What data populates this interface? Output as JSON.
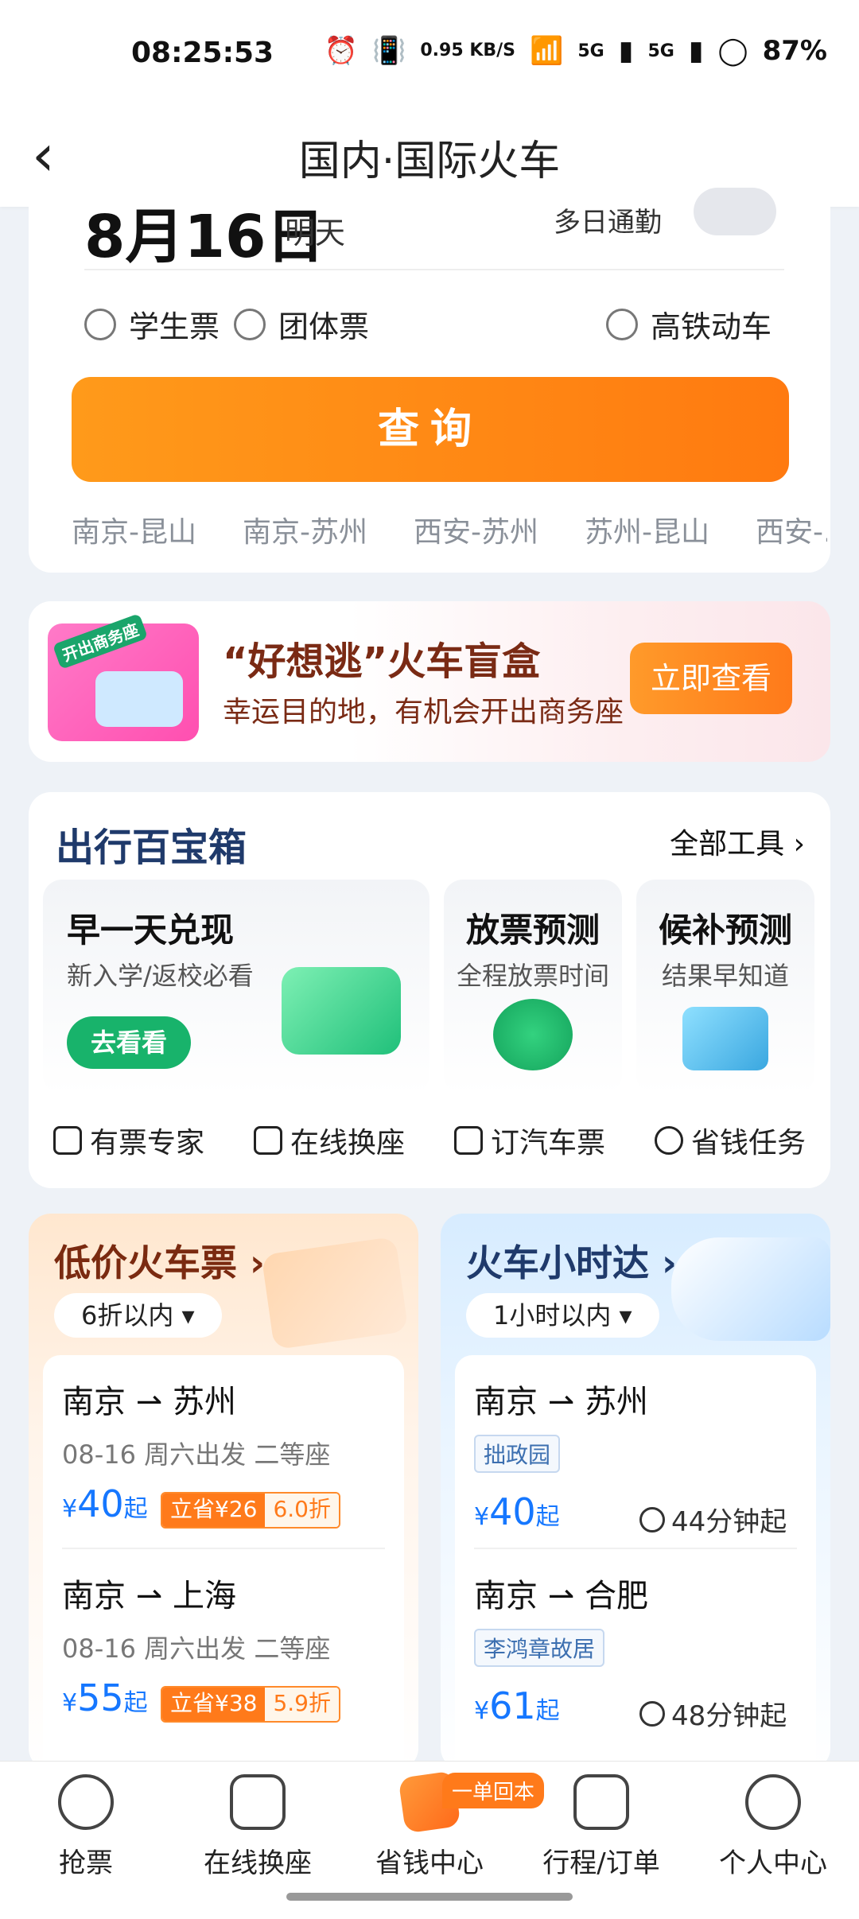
{
  "status": {
    "time": "08:25:53",
    "net_speed": "0.95 KB/S",
    "signal_a": "5G",
    "signal_b": "5G",
    "battery": "87%"
  },
  "header": {
    "title": "国内·国际火车"
  },
  "search": {
    "date": "8月16日",
    "date_sub": "明天",
    "multi_day": "多日通勤",
    "options": [
      "学生票",
      "团体票",
      "高铁动车"
    ],
    "query_button": "查询",
    "history": [
      "南京-昆山",
      "南京-苏州",
      "西安-苏州",
      "苏州-昆山",
      "西安-..."
    ]
  },
  "banner": {
    "gift_tag": "开出商务座",
    "title": "“好想逃”火车盲盒",
    "subtitle": "幸运目的地，有机会开出商务座",
    "button": "立即查看"
  },
  "toolbox": {
    "title": "出行百宝箱",
    "all_tools": "全部工具 ›",
    "tiles": [
      {
        "title": "早一天兑现",
        "sub": "新入学/返校必看",
        "button": "去看看"
      },
      {
        "title": "放票预测",
        "sub": "全程放票时间"
      },
      {
        "title": "候补预测",
        "sub": "结果早知道"
      }
    ],
    "tools": [
      "有票专家",
      "在线换座",
      "订汽车票",
      "省钱任务"
    ]
  },
  "low_price": {
    "title": "低价火车票 ›",
    "filter": "6折以内 ▾",
    "items": [
      {
        "route": "南京 ⇀ 苏州",
        "meta": "08-16 周六出发   二等座",
        "price": "40",
        "save": "立省¥26",
        "discount": "6.0折"
      },
      {
        "route": "南京 ⇀ 上海",
        "meta": "08-16 周六出发   二等座",
        "price": "55",
        "save": "立省¥38",
        "discount": "5.9折"
      }
    ],
    "currency": "¥",
    "price_suffix": "起"
  },
  "fast_train": {
    "title": "火车小时达 ›",
    "filter": "1小时以内 ▾",
    "items": [
      {
        "route": "南京 ⇀ 苏州",
        "sight": "拙政园",
        "price": "40",
        "duration": "44分钟起"
      },
      {
        "route": "南京 ⇀ 合肥",
        "sight": "李鸿章故居",
        "price": "61",
        "duration": "48分钟起"
      }
    ],
    "currency": "¥",
    "price_suffix": "起"
  },
  "tabbar": {
    "tabs": [
      "抢票",
      "在线换座",
      "省钱中心",
      "行程/订单",
      "个人中心"
    ],
    "badge": "一单回本",
    "colors": {
      "accent": "#ff7a1a",
      "price_blue": "#1677ff",
      "brand_green": "#18b36b"
    }
  }
}
